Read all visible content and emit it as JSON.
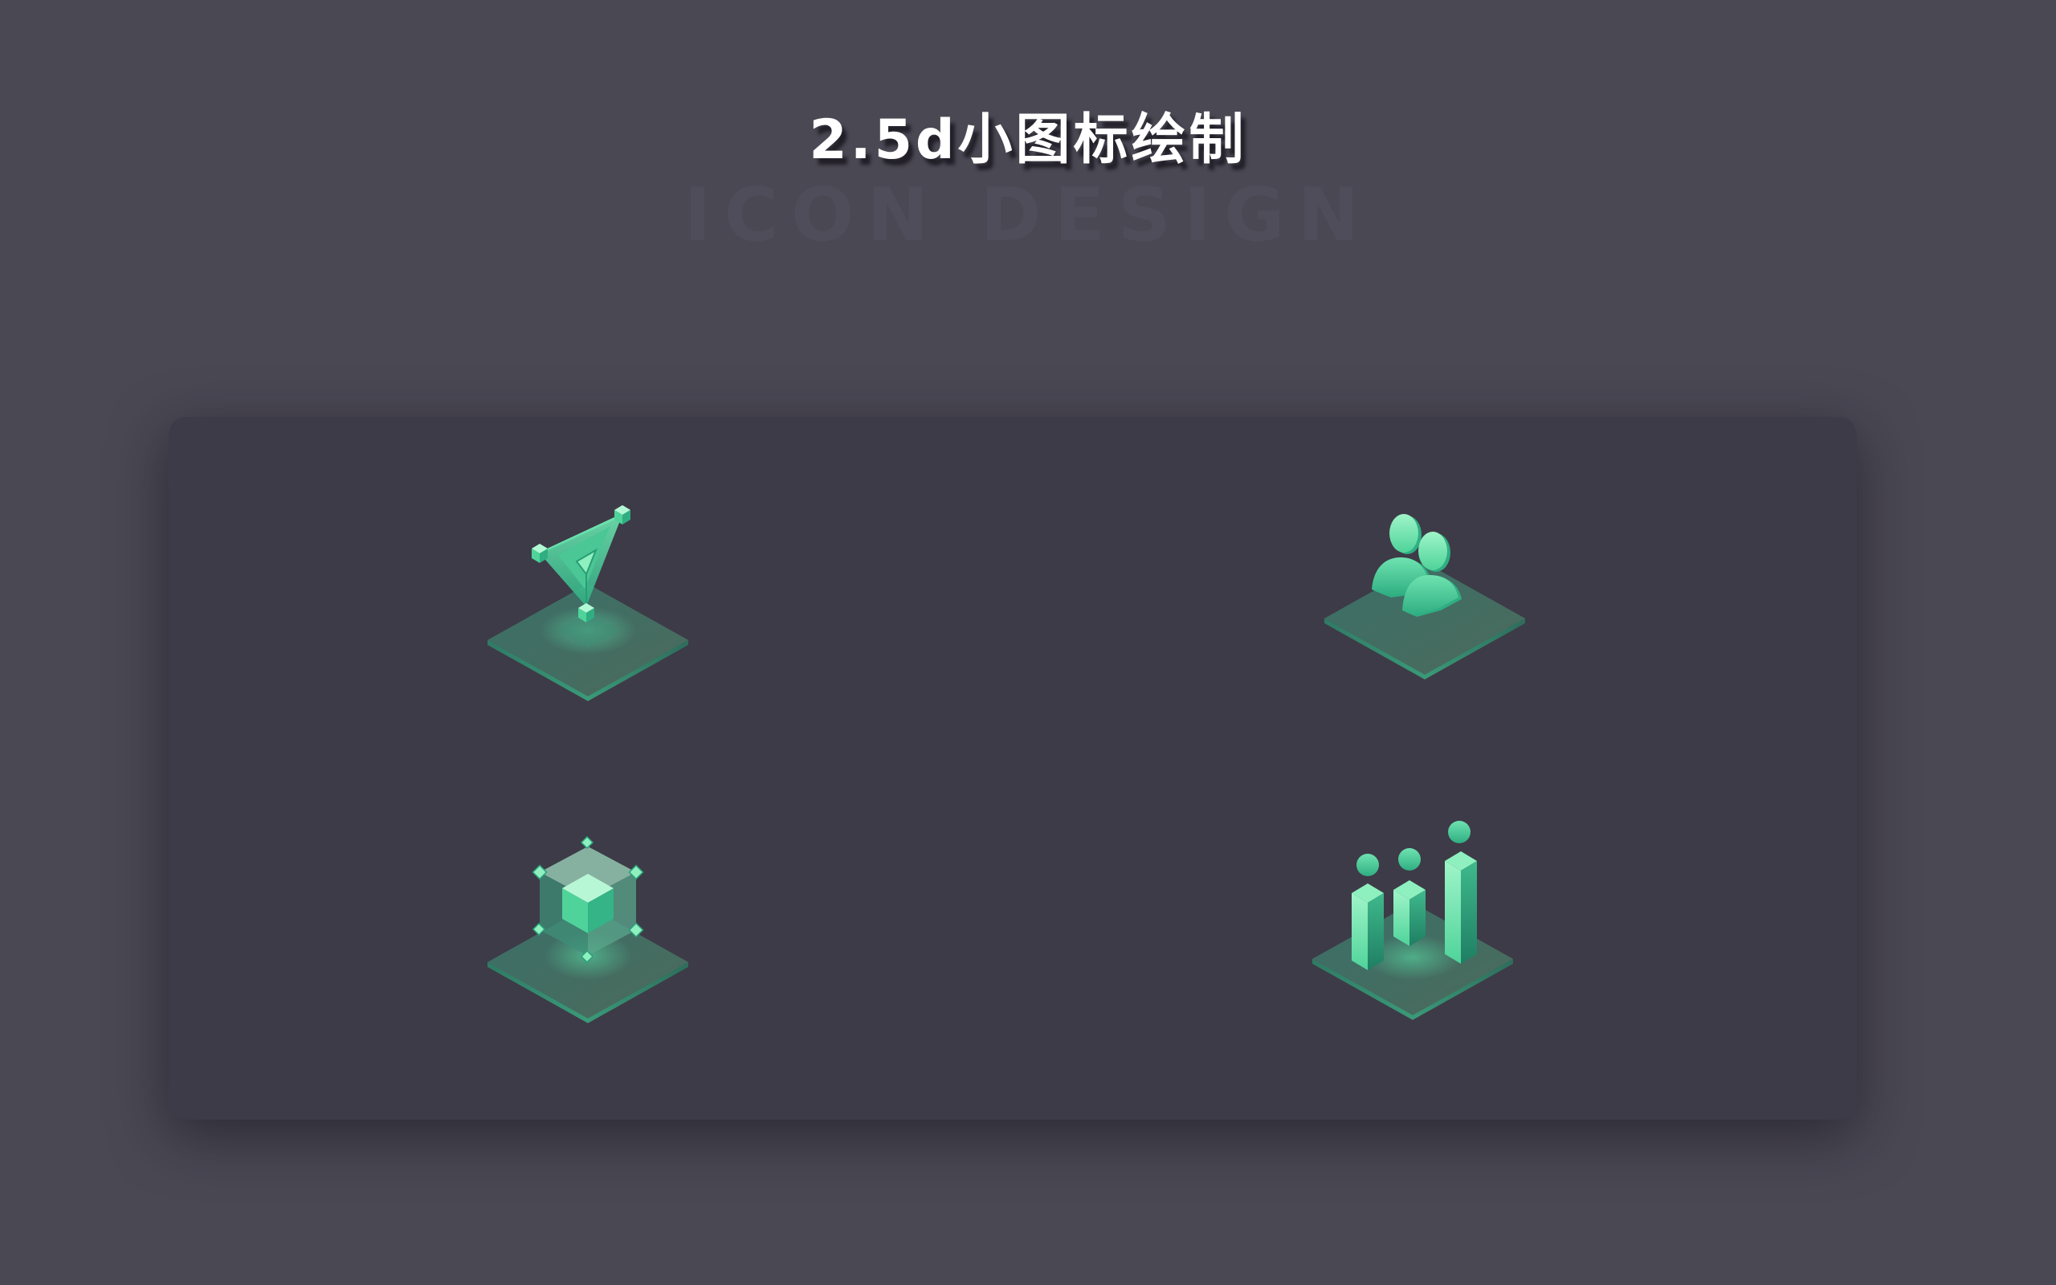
{
  "header": {
    "title": "2.5d小图标绘制",
    "subtitle": "ICON DESIGN"
  },
  "colors": {
    "background": "#4a4853",
    "panel": "#3d3b47",
    "accent_light": "#8ff0bf",
    "accent": "#4fd39a",
    "accent_dark": "#2aa07a"
  },
  "icons": [
    {
      "name": "vector-pen-icon",
      "description": "isometric pen tool with anchor points"
    },
    {
      "name": "users-icon",
      "description": "isometric two users"
    },
    {
      "name": "cube-3d-icon",
      "description": "isometric 3D cube with control points"
    },
    {
      "name": "bar-chart-icon",
      "description": "isometric bar chart with dots"
    }
  ]
}
